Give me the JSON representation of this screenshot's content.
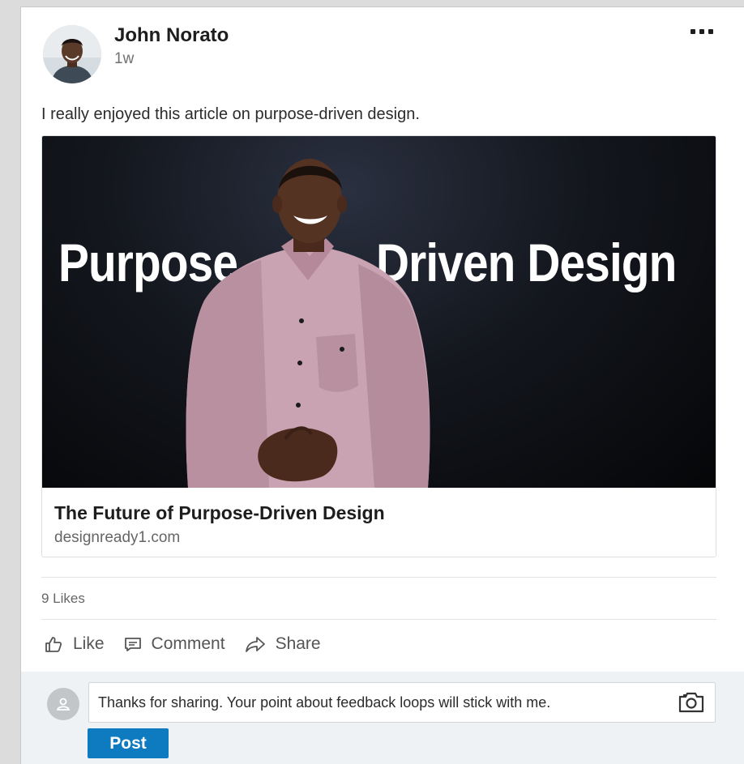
{
  "post": {
    "author_name": "John Norato",
    "time_ago": "1w",
    "text": "I really enjoyed this article on purpose-driven design."
  },
  "article": {
    "headline_left": "Purpose",
    "headline_right": "Driven Design",
    "title": "The Future of Purpose-Driven Design",
    "domain": "designready1.com"
  },
  "stats": {
    "likes": "9 Likes"
  },
  "actions": {
    "like": "Like",
    "comment": "Comment",
    "share": "Share"
  },
  "comment_box": {
    "value": "Thanks for sharing. Your point about feedback loops will stick with me.",
    "post_label": "Post"
  },
  "icons": {
    "more": "more-options-icon",
    "like": "thumbs-up-icon",
    "comment": "comment-icon",
    "share": "share-arrow-icon",
    "camera": "camera-icon",
    "commenter": "user-placeholder-icon"
  },
  "colors": {
    "accent": "#0e7bc0",
    "comment_bg": "#eef2f5"
  }
}
